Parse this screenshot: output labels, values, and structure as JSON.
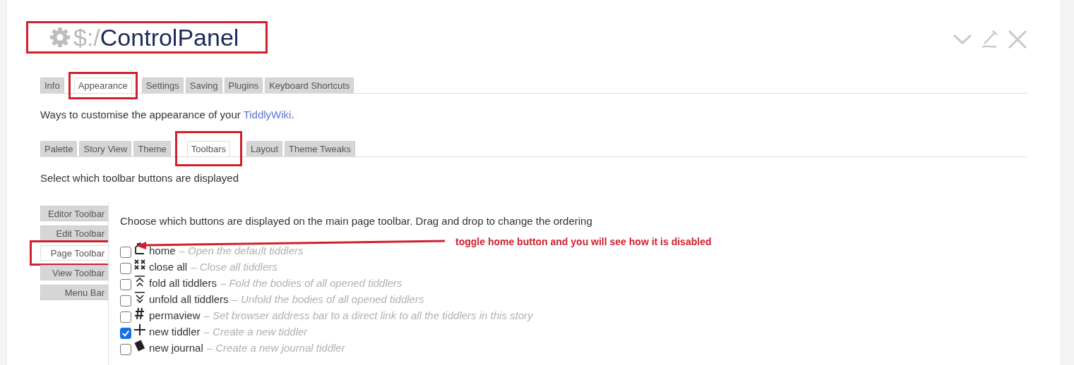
{
  "title": {
    "prefix": "$:/",
    "name": "ControlPanel",
    "highlighted": true
  },
  "tabs": [
    {
      "label": "Info",
      "selected": false,
      "highlighted": false
    },
    {
      "label": "Appearance",
      "selected": true,
      "highlighted": true
    },
    {
      "label": "Settings",
      "selected": false,
      "highlighted": false
    },
    {
      "label": "Saving",
      "selected": false,
      "highlighted": false
    },
    {
      "label": "Plugins",
      "selected": false,
      "highlighted": false
    },
    {
      "label": "Keyboard Shortcuts",
      "selected": false,
      "highlighted": false
    }
  ],
  "intro": {
    "text": "Ways to customise the appearance of your ",
    "link": "TiddlyWiki",
    "end": "."
  },
  "subtabs": [
    {
      "label": "Palette",
      "selected": false,
      "highlighted": false
    },
    {
      "label": "Story View",
      "selected": false,
      "highlighted": false
    },
    {
      "label": "Theme",
      "selected": false,
      "highlighted": false
    },
    {
      "label": "Toolbars",
      "selected": true,
      "highlighted": true
    },
    {
      "label": "Layout",
      "selected": false,
      "highlighted": false
    },
    {
      "label": "Theme Tweaks",
      "selected": false,
      "highlighted": false
    }
  ],
  "subtab_intro": "Select which toolbar buttons are displayed",
  "sidebar": [
    {
      "label": "Editor Toolbar",
      "selected": false,
      "highlighted": false
    },
    {
      "label": "Edit Toolbar",
      "selected": false,
      "highlighted": false
    },
    {
      "label": "Page Toolbar",
      "selected": true,
      "highlighted": true
    },
    {
      "label": "View Toolbar",
      "selected": false,
      "highlighted": false
    },
    {
      "label": "Menu Bar",
      "selected": false,
      "highlighted": false
    }
  ],
  "panel_intro": "Choose which buttons are displayed on the main page toolbar. Drag and drop to change the ordering",
  "buttons": [
    {
      "kind": "home",
      "name": "home",
      "description": "– Open the default tiddlers",
      "checked": false
    },
    {
      "kind": "close-all",
      "name": "close all",
      "description": "– Close all tiddlers",
      "checked": false
    },
    {
      "kind": "fold",
      "name": "fold all tiddlers",
      "description": "– Fold the bodies of all opened tiddlers",
      "checked": false
    },
    {
      "kind": "unfold",
      "name": "unfold all tiddlers",
      "description": "– Unfold the bodies of all opened tiddlers",
      "checked": false
    },
    {
      "kind": "permaview",
      "name": "permaview",
      "description": "– Set browser address bar to a direct link to all the tiddlers in this story",
      "checked": false
    },
    {
      "kind": "new-tiddler",
      "name": "new tiddler",
      "description": "– Create a new tiddler",
      "checked": true
    },
    {
      "kind": "new-journal",
      "name": "new journal",
      "description": "– Create a new journal tiddler",
      "checked": false
    }
  ],
  "annotation": {
    "text": "toggle home button and you will see how it is disabled"
  }
}
